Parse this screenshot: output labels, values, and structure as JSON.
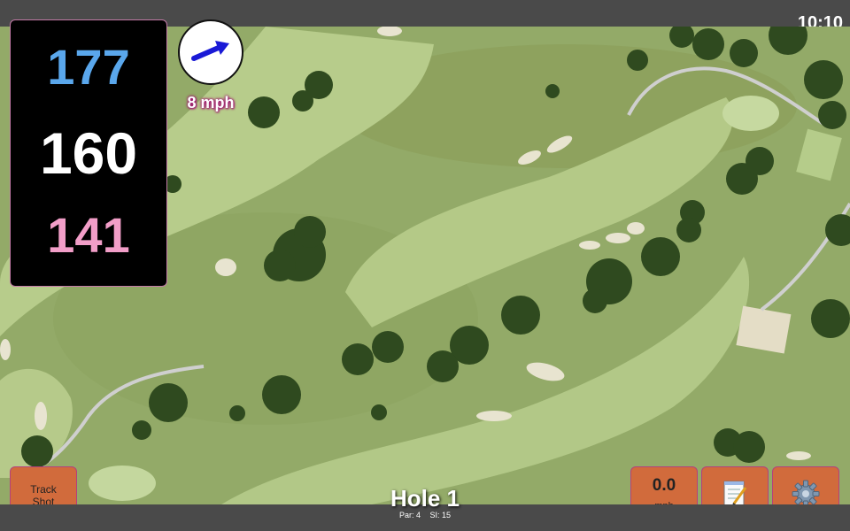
{
  "status_bar": {
    "time": "10:10"
  },
  "distances": {
    "back": "177",
    "middle": "160",
    "front": "141"
  },
  "wind": {
    "speed": "8 mph",
    "direction_icon": "arrow-icon"
  },
  "buttons": {
    "track_shot_line1": "Track",
    "track_shot_line2": "Shot",
    "speed_value": "0.0",
    "speed_unit": "mph",
    "notes_icon": "notepad-icon",
    "settings_icon": "gear-icon"
  },
  "hole": {
    "title": "Hole 1",
    "par": "Par: 4",
    "si": "SI: 15"
  },
  "colors": {
    "back_distance": "#5aa7ec",
    "middle_distance": "#ffffff",
    "front_distance": "#f29ec8",
    "button_bg": "#d16b3c",
    "wind_arrow": "#1a1ad6"
  }
}
